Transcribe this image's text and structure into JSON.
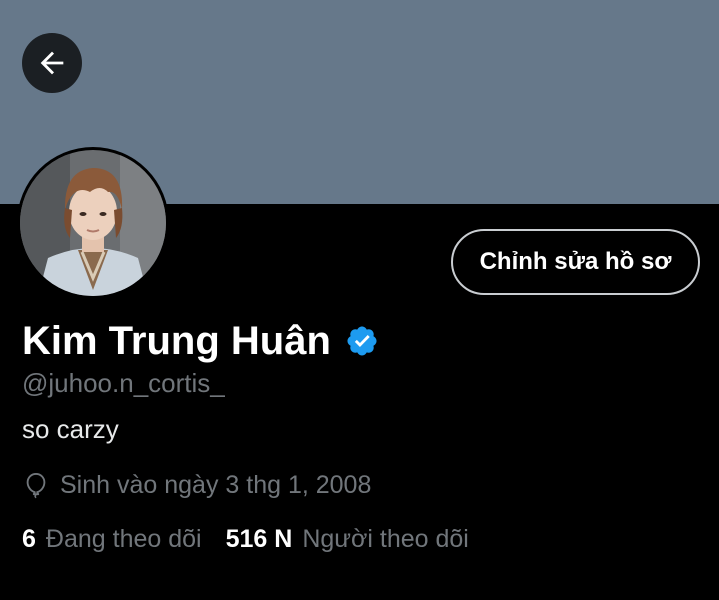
{
  "profile": {
    "display_name": "Kim Trung Huân",
    "handle": "@juhoo.n_cortis_",
    "bio": "so carzy",
    "birth_text": "Sinh vào ngày 3 thg 1, 2008",
    "verified": true
  },
  "actions": {
    "edit_profile_label": "Chỉnh sửa hồ sơ",
    "back_icon": "arrow-left-icon"
  },
  "stats": {
    "following_count": "6",
    "following_label": "Đang theo dõi",
    "followers_count": "516 N",
    "followers_label": "Người theo dõi"
  },
  "icons": {
    "birth": "balloon-icon",
    "verified": "verified-badge-icon"
  },
  "colors": {
    "banner": "#66788a",
    "background": "#000000",
    "verified_badge": "#1d9bf0",
    "secondary_text": "#71767b",
    "button_border": "#c9cdd1"
  }
}
